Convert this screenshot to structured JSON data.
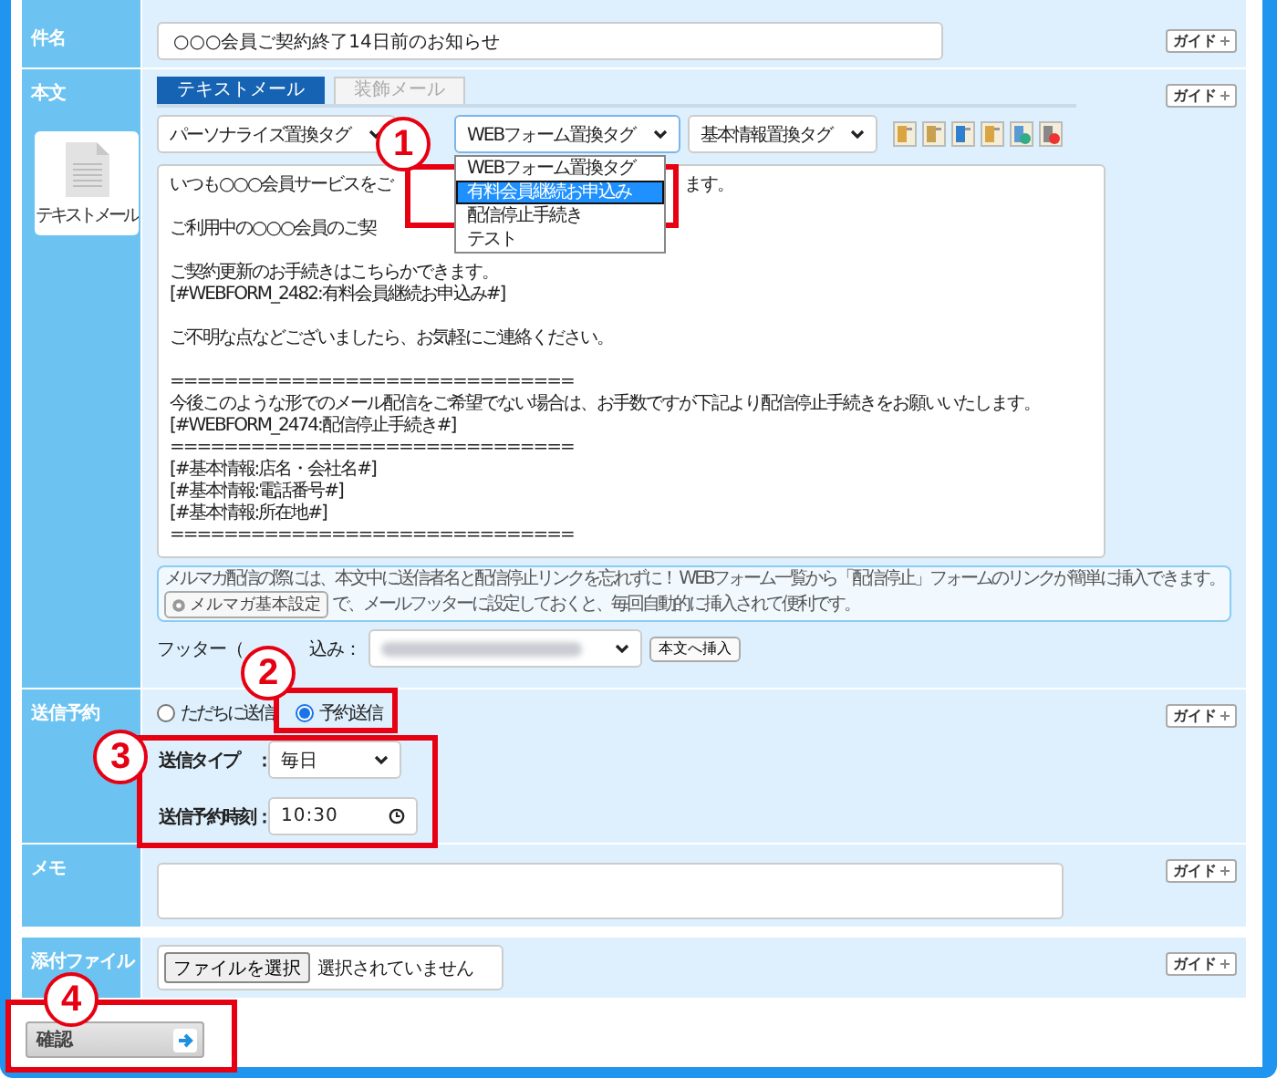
{
  "subject": {
    "label": "件名",
    "value": "○○○会員ご契約終了14日前のお知らせ",
    "guide": "ガイド"
  },
  "body": {
    "label": "本文",
    "format_card": "テキストメール",
    "guide": "ガイド",
    "tabs": [
      {
        "label": "テキストメール",
        "selected": true
      },
      {
        "label": "装飾メール",
        "selected": false
      }
    ],
    "tag_selects": [
      {
        "value": "パーソナライズ置換タグ",
        "expanded": false
      },
      {
        "value": "WEBフォーム置換タグ",
        "expanded": true
      },
      {
        "value": "基本情報置換タグ",
        "expanded": false
      }
    ],
    "webform_options": [
      {
        "label": "WEBフォーム置換タグ",
        "selected": false
      },
      {
        "label": "有料会員継続お申込み",
        "selected": true
      },
      {
        "label": "配信停止手続き",
        "selected": false
      },
      {
        "label": "テスト",
        "selected": false
      }
    ],
    "text_blocks": [
      [
        {
          "text": "いつも○○○会員サービスをご",
          "tail": "ます。"
        }
      ],
      [
        {
          "text": "ご利用中の○○○会員のご契"
        }
      ],
      [
        {
          "text": "ご契約更新のお手続きはこちらかできます。"
        },
        {
          "text": "[#WEBFORM_2482:有料会員継続お申込み#]"
        }
      ],
      [
        {
          "text": "ご不明な点などございましたら、お気軽にご連絡ください。"
        }
      ],
      [
        {
          "text": "=============================="
        },
        {
          "text": "今後このような形でのメール配信をご希望でない場合は、お手数ですが下記より配信停止手続きをお願いいたします。"
        },
        {
          "text": "[#WEBFORM_2474:配信停止手続き#]"
        },
        {
          "text": "=============================="
        },
        {
          "text": "[#基本情報:店名・会社名#]"
        },
        {
          "text": "[#基本情報:電話番号#]"
        },
        {
          "text": "[#基本情報:所在地#]"
        },
        {
          "text": "=============================="
        }
      ]
    ],
    "notice": {
      "line_1": "メルマガ配信の際には、本文中に送信者名と配信停止リンクを忘れずに！ WEBフォーム一覧から「配信停止」フォームのリンクが簡単に挿入できます。",
      "settings_button": "メルマガ基本設定",
      "line_2": "で、メールフッターに設定しておくと、毎回自動的に挿入されて便利です。"
    },
    "footer": {
      "label_start": "フッター（",
      "label_end": "込み：",
      "insert_button": "本文へ挿入"
    }
  },
  "schedule": {
    "label": "送信予約",
    "guide": "ガイド",
    "options": [
      {
        "label": "ただちに送信",
        "selected": false
      },
      {
        "label": "予約送信",
        "selected": true
      }
    ],
    "send_type_label": "送信タイプ　：",
    "send_type": "毎日",
    "time_label": "送信予約時刻：",
    "time": "10:30"
  },
  "memo": {
    "label": "メモ",
    "guide": "ガイド"
  },
  "attachment": {
    "label": "添付ファイル",
    "choose_button": "ファイルを選択",
    "status": "選択されていません",
    "guide": "ガイド"
  },
  "confirm_button": "確認",
  "annotations": [
    {
      "label": "1"
    },
    {
      "label": "2"
    },
    {
      "label": "3"
    },
    {
      "label": "4"
    }
  ]
}
